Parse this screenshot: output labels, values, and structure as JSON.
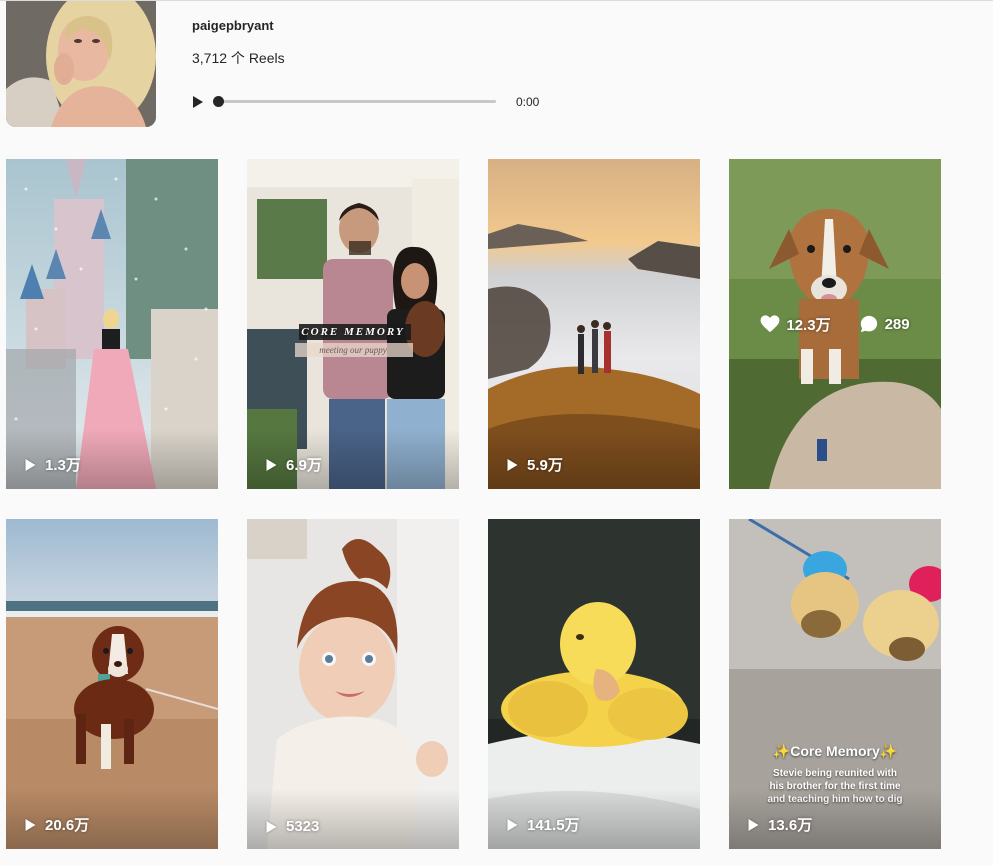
{
  "profile": {
    "username": "paigepbryant",
    "reels_count": "3,712 个 Reels"
  },
  "player": {
    "time": "0:00",
    "progress": 0
  },
  "reels": [
    {
      "views": "1.3万",
      "scene": "castle"
    },
    {
      "views": "6.9万",
      "scene": "couple",
      "overlay_title": "CORE MEMORY",
      "overlay_sub": "meeting our puppy"
    },
    {
      "views": "5.9万",
      "scene": "mountain"
    },
    {
      "likes": "12.3万",
      "comments": "289",
      "scene": "dog"
    },
    {
      "views": "20.6万",
      "scene": "puppy-beach"
    },
    {
      "views": "5323",
      "scene": "baby"
    },
    {
      "views": "141.5万",
      "scene": "duckling"
    },
    {
      "views": "13.6万",
      "scene": "sand-dogs",
      "overlay_title": "✨Core Memory✨",
      "overlay_body": "Stevie being reunited with his brother for the first time and teaching him how to dig"
    }
  ],
  "icons": {
    "play": "play-icon",
    "heart": "heart-icon",
    "comment": "comment-icon"
  }
}
